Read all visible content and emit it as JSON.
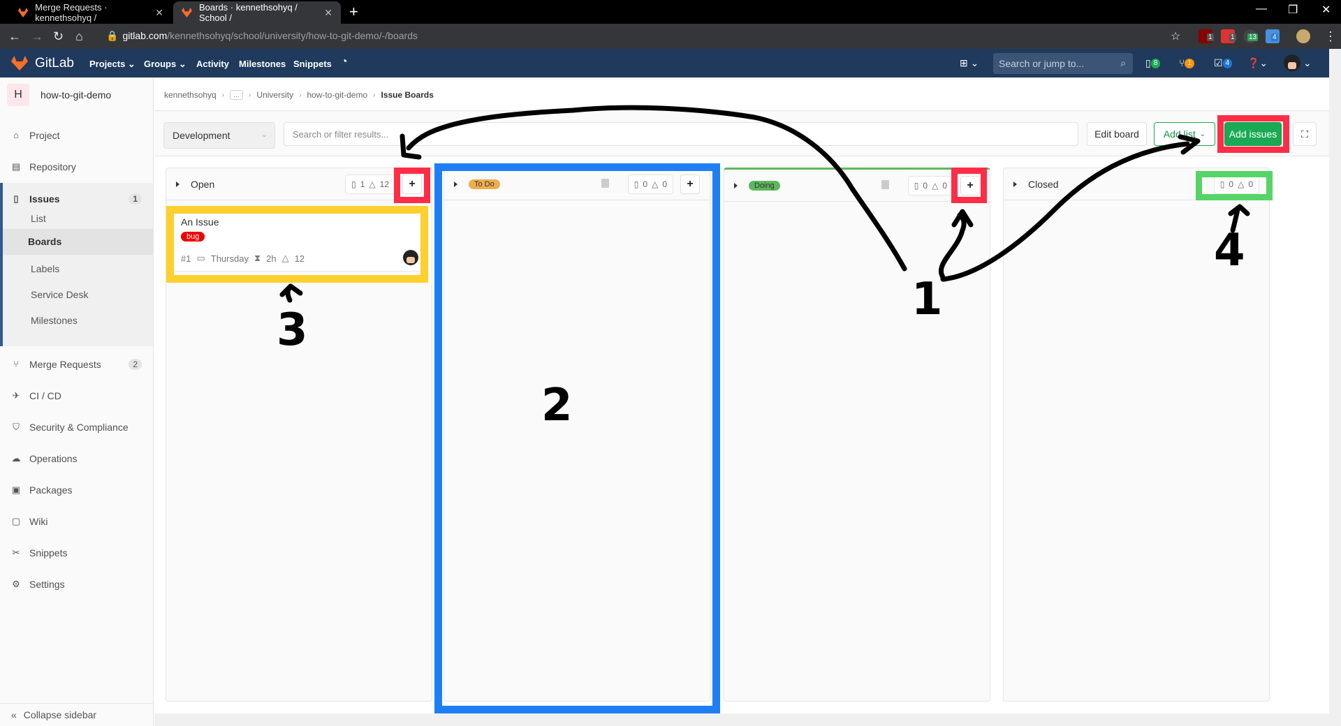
{
  "browser": {
    "tabs": [
      {
        "title": "Merge Requests · kennethsohyq /",
        "active": false
      },
      {
        "title": "Boards · kennethsohyq / School /",
        "active": true
      }
    ],
    "url_host": "gitlab.com",
    "url_path": "/kennethsohyq/school/university/how-to-git-demo/-/boards",
    "extension_badges": [
      "1",
      "1",
      "13",
      "4"
    ]
  },
  "gitlab_nav": {
    "brand": "GitLab",
    "items": [
      "Projects ⌄",
      "Groups ⌄",
      "Activity",
      "Milestones",
      "Snippets"
    ],
    "search_placeholder": "Search or jump to...",
    "issues_count": "8",
    "mr_count": "1",
    "todo_count": "4",
    "colors": {
      "bg": "#1f3a5c",
      "issues_badge": "#1aaa55",
      "mr_badge": "#fc9403",
      "todo_badge": "#1f78d1"
    }
  },
  "sidebar": {
    "project_initial": "H",
    "project_name": "how-to-git-demo",
    "items": [
      {
        "label": "Project",
        "icon": "home-icon"
      },
      {
        "label": "Repository",
        "icon": "doc-icon"
      },
      {
        "label": "Issues",
        "icon": "issues-icon",
        "badge": "1"
      },
      {
        "label": "Merge Requests",
        "icon": "merge-request-icon",
        "badge": "2"
      },
      {
        "label": "CI / CD",
        "icon": "rocket-icon"
      },
      {
        "label": "Security & Compliance",
        "icon": "shield-icon"
      },
      {
        "label": "Operations",
        "icon": "cloud-gear-icon"
      },
      {
        "label": "Packages",
        "icon": "package-icon"
      },
      {
        "label": "Wiki",
        "icon": "book-icon"
      },
      {
        "label": "Snippets",
        "icon": "scissors-icon"
      },
      {
        "label": "Settings",
        "icon": "gear-icon"
      }
    ],
    "issues_sub": [
      "List",
      "Boards",
      "Labels",
      "Service Desk",
      "Milestones"
    ],
    "collapse_label": "Collapse sidebar"
  },
  "breadcrumb": [
    "kennethsohyq",
    "…",
    "University",
    "how-to-git-demo",
    "Issue Boards"
  ],
  "toolbar": {
    "board_select": "Development",
    "search_placeholder": "Search or filter results...",
    "edit_board": "Edit board",
    "add_list": "Add list",
    "add_issues": "Add issues"
  },
  "board": {
    "columns": [
      {
        "title": "Open",
        "type": "plain",
        "issues": "1",
        "weight": "12"
      },
      {
        "title": "To Do",
        "type": "label",
        "label_color": "#f0ad4e",
        "issues": "0",
        "weight": "0"
      },
      {
        "title": "Doing",
        "type": "label",
        "label_color": "#5cb85c",
        "issues": "0",
        "weight": "0"
      },
      {
        "title": "Closed",
        "type": "plain",
        "issues": "0",
        "weight": "0"
      }
    ],
    "card": {
      "title": "An Issue",
      "label": "bug",
      "label_color": "#ee0000",
      "number": "#1",
      "due": "Thursday",
      "time_estimate": "2h",
      "weight": "12"
    }
  },
  "annotations": {
    "numbers": [
      "1",
      "2",
      "3",
      "4"
    ],
    "colors": {
      "red": "#ff2d46",
      "blue": "#1e7ff5",
      "yellow": "#ffd02e",
      "green": "#57d467"
    }
  }
}
